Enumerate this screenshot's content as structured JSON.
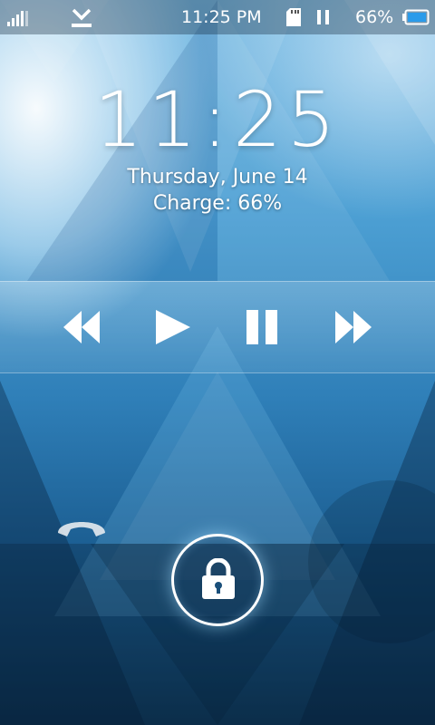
{
  "status_bar": {
    "signal_icon": "signal-bars-icon",
    "download_icon": "download-complete-icon",
    "time": "11:25 PM",
    "sd_icon": "sd-card-icon",
    "media_icon": "pause-icon",
    "battery_percent": "66%",
    "battery_icon": "battery-icon"
  },
  "lockscreen": {
    "clock": "11:25",
    "date": "Thursday, June 14",
    "charge": "Charge: 66%"
  },
  "music_controls": {
    "rewind": "rewind-icon",
    "play": "play-icon",
    "pause": "pause-icon",
    "fast_forward": "fast-forward-icon"
  },
  "unlock": {
    "phone_icon": "phone-icon",
    "lock_icon": "lock-icon"
  },
  "colors": {
    "accent": "#4c9fd3",
    "battery_fill": "#2a9bea"
  }
}
